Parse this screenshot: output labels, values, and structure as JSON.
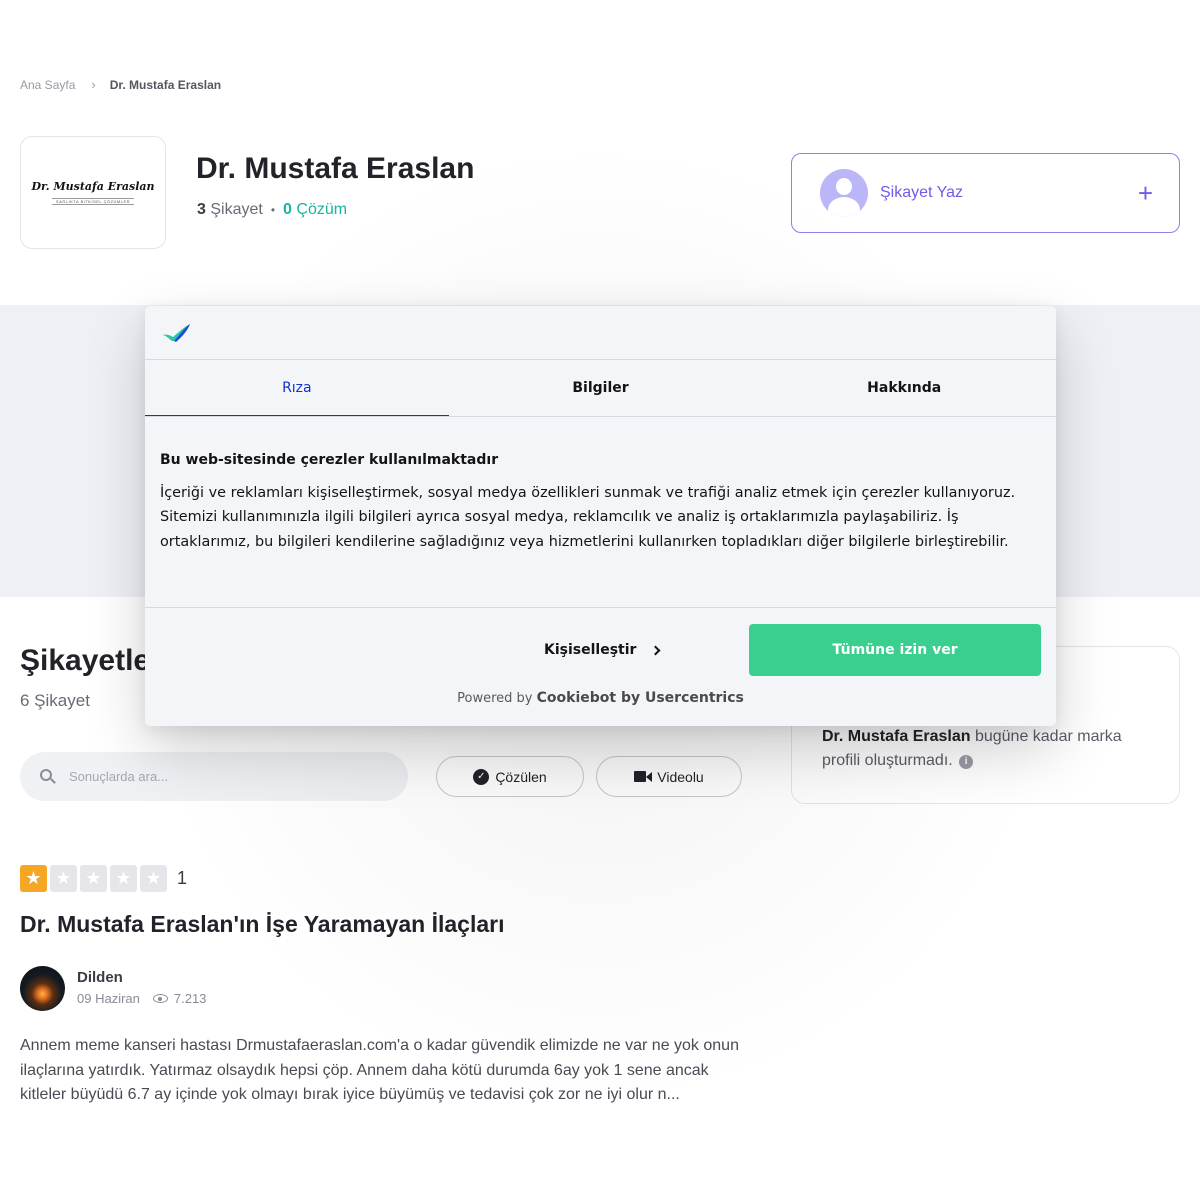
{
  "breadcrumb": {
    "home": "Ana Sayfa",
    "current": "Dr. Mustafa Eraslan"
  },
  "brand": {
    "logo_text": "Dr. Mustafa Eraslan",
    "logo_tagline": "SAĞLIKTA BİTKİSEL ÇÖZÜMLER",
    "name": "Dr. Mustafa Eraslan",
    "complaint_count": "3",
    "complaint_label": "Şikayet",
    "separator": "•",
    "solution_count": "0",
    "solution_label": "Çözüm"
  },
  "write_complaint": {
    "label": "Şikayet Yaz",
    "plus": "+"
  },
  "complaints_section": {
    "title": "Şikayetler",
    "count_text": "6 Şikayet"
  },
  "search": {
    "placeholder": "Sonuçlarda ara..."
  },
  "filters": {
    "solved": "Çözülen",
    "video": "Videolu"
  },
  "info": {
    "brand": "Dr. Mustafa Eraslan",
    "text": " bugüne kadar marka profili oluşturmadı.",
    "icon": "i"
  },
  "complaint": {
    "rating": 1,
    "rating_text": "1",
    "title": "Dr. Mustafa Eraslan'ın İşe Yaramayan İlaçları",
    "author": "Dilden",
    "date": "09 Haziran",
    "views": "7.213",
    "body": "Annem meme kanseri hastası Drmustafaeraslan.com'a o kadar güvendik elimizde ne var ne yok onun ilaçlarına yatırdık. Yatırmaz olsaydık hepsi çöp. Annem daha kötü durumda 6ay yok 1 sene ancak kitleler büyüdü 6.7 ay içinde yok olmayı bırak iyice büyümüş ve tedavisi çok zor ne iyi olur n..."
  },
  "cookie": {
    "tabs": [
      "Rıza",
      "Bilgiler",
      "Hakkında"
    ],
    "heading": "Bu web-sitesinde çerezler kullanılmaktadır",
    "text": "İçeriği ve reklamları kişiselleştirmek, sosyal medya özellikleri sunmak ve trafiği analiz etmek için çerezler kullanıyoruz. Sitemizi kullanımınızla ilgili bilgileri ayrıca sosyal medya, reklamcılık ve analiz iş ortaklarımızla paylaşabiliriz. İş ortaklarımız, bu bilgileri kendilerine sağladığınız veya hizmetlerini kullanırken topladıkları diğer bilgilerle birleştirebilir.",
    "customize": "Kişiselleştir",
    "allow_all": "Tümüne izin ver",
    "powered_prefix": "Powered by ",
    "powered_brand": "Cookiebot by Usercentrics"
  },
  "icons": {
    "search": "search-icon",
    "check": "check-circle-icon",
    "video": "video-camera-icon",
    "eye": "eye-icon",
    "plus": "plus-icon",
    "chevron": "chevron-right-icon",
    "star": "star-icon"
  },
  "colors": {
    "accent": "#6c5ce7",
    "solved": "#16b5a0",
    "star": "#f5a623",
    "cookie_active": "#1032cf",
    "cookie_allow": "#3acf8f"
  }
}
